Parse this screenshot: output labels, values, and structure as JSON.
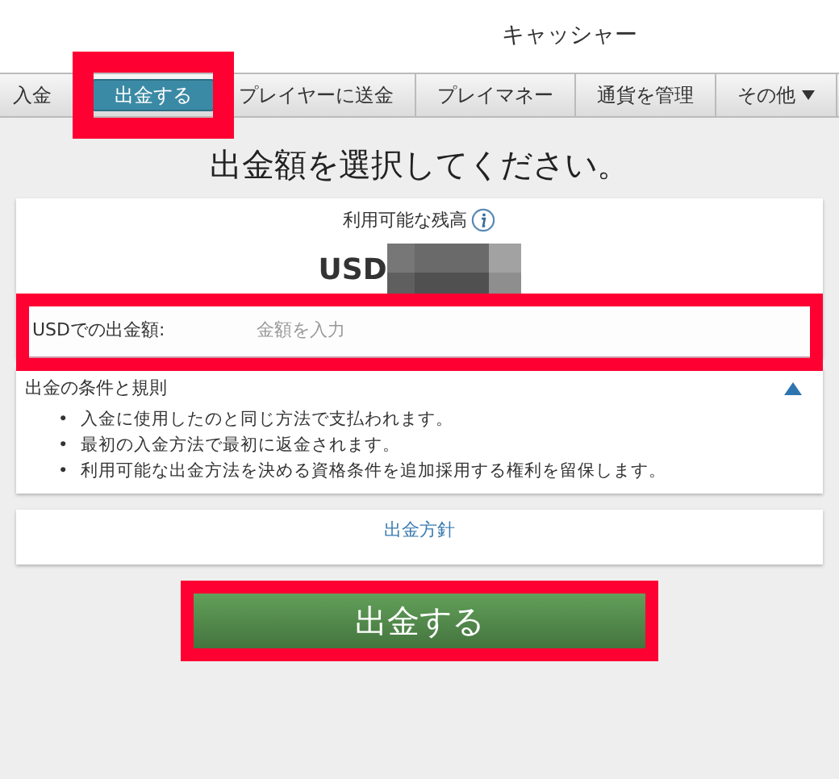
{
  "header": {
    "title": "キャッシャー"
  },
  "tabs": [
    {
      "label": "入金",
      "selected": false,
      "highlighted": false
    },
    {
      "label": "出金する",
      "selected": true,
      "highlighted": true
    },
    {
      "label": "プレイヤーに送金",
      "selected": false,
      "highlighted": false
    },
    {
      "label": "プレイマネー",
      "selected": false,
      "highlighted": false
    },
    {
      "label": "通貨を管理",
      "selected": false,
      "highlighted": false
    },
    {
      "label": "その他",
      "selected": false,
      "highlighted": false,
      "dropdown": true
    }
  ],
  "heading": "出金額を選択してください。",
  "balance": {
    "label": "利用可能な残高",
    "currency": "USD"
  },
  "amount_field": {
    "label": "USDでの出金額:",
    "placeholder": "金額を入力",
    "highlighted": true
  },
  "terms": {
    "title": "出金の条件と規則",
    "expanded": true,
    "bullet": "•",
    "items": [
      "入金に使用したのと同じ方法で支払われます。",
      "最初の入金方法で最初に返金されます。",
      "利用可能な出金方法を決める資格条件を追加採用する権利を留保します。"
    ]
  },
  "policy_link": "出金方針",
  "withdraw_button": {
    "label": "出金する",
    "highlighted": true
  }
}
